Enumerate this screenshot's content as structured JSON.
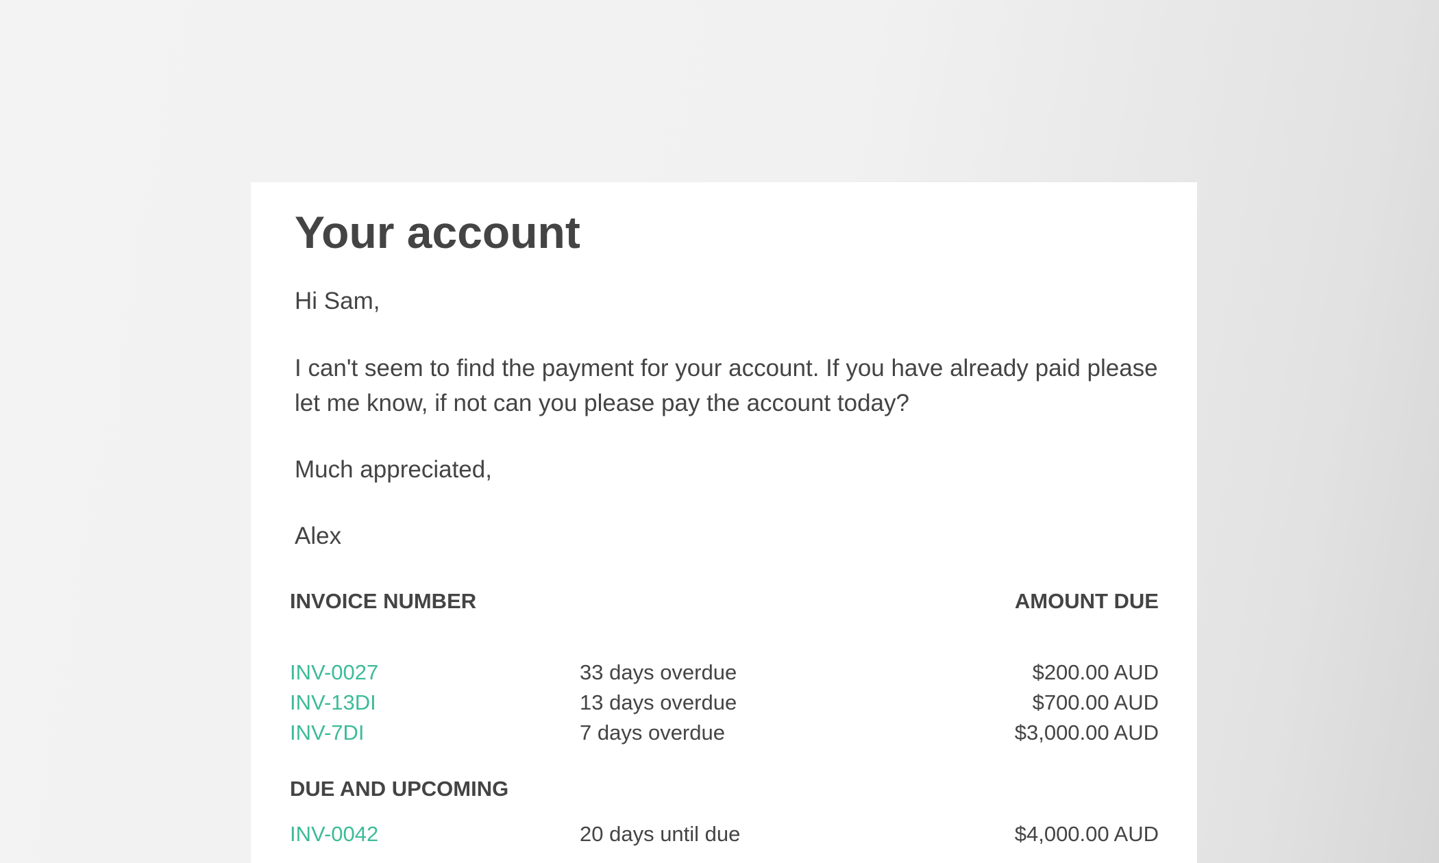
{
  "email": {
    "title": "Your account",
    "greeting": "Hi Sam,",
    "body": "I can't seem to find the payment for your account. If you have already paid please let me know, if not can you please pay the account today?",
    "closing": "Much appreciated,",
    "signature": "Alex"
  },
  "invoices": {
    "header_invoice": "INVOICE NUMBER",
    "header_amount": "AMOUNT DUE",
    "overdue": [
      {
        "number": "INV-0027",
        "status": "33 days overdue",
        "amount": "$200.00 AUD"
      },
      {
        "number": "INV-13DI",
        "status": "13 days overdue",
        "amount": "$700.00 AUD"
      },
      {
        "number": "INV-7DI",
        "status": "7 days overdue",
        "amount": "$3,000.00 AUD"
      }
    ],
    "upcoming_header": "DUE AND UPCOMING",
    "upcoming": [
      {
        "number": "INV-0042",
        "status": "20 days until due",
        "amount": "$4,000.00 AUD"
      }
    ]
  },
  "colors": {
    "link": "#3dbb98",
    "text": "#444444",
    "card": "#ffffff"
  }
}
